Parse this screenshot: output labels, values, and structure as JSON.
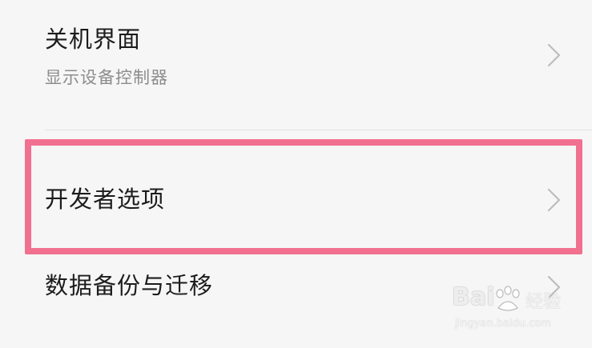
{
  "settings": {
    "items": [
      {
        "title": "关机界面",
        "subtitle": "显示设备控制器"
      },
      {
        "title": "开发者选项"
      },
      {
        "title": "数据备份与迁移"
      }
    ]
  },
  "highlight": {
    "color": "#f2708f"
  },
  "icons": {
    "chevron": "chevron-right-icon"
  },
  "watermark": {
    "logo_text_left": "Bai",
    "logo_text_right": "经验",
    "url": "jingyan.baidu.com"
  }
}
